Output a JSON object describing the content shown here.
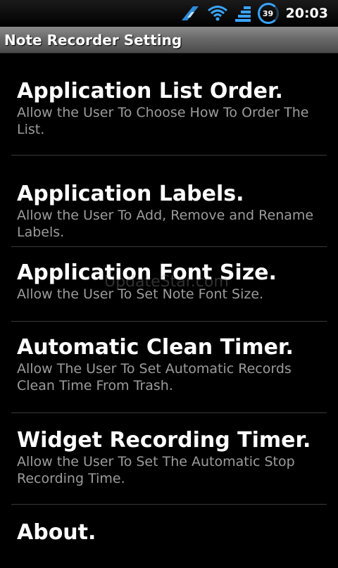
{
  "status_bar": {
    "battery_level": "39",
    "time": "20:03",
    "icons": [
      "usb-debug-icon",
      "wifi-icon",
      "signal-icon",
      "battery-icon"
    ]
  },
  "title_bar": {
    "title": "Note Recorder Setting"
  },
  "settings": [
    {
      "title": "Application List Order.",
      "summary": "Allow the User To Choose How To Order The List."
    },
    {
      "title": "Application Labels.",
      "summary": "Allow the User To Add, Remove and Rename Labels."
    },
    {
      "title": "Application Font Size.",
      "summary": "Allow the User To Set Note Font Size."
    },
    {
      "title": "Automatic Clean Timer.",
      "summary": "Allow The User To Set Automatic Records Clean Time From Trash."
    },
    {
      "title": "Widget Recording Timer.",
      "summary": "Allow the User To Set The Automatic Stop Recording Time."
    },
    {
      "title": "About.",
      "summary": ""
    }
  ],
  "watermark": "UpdateStar.com"
}
